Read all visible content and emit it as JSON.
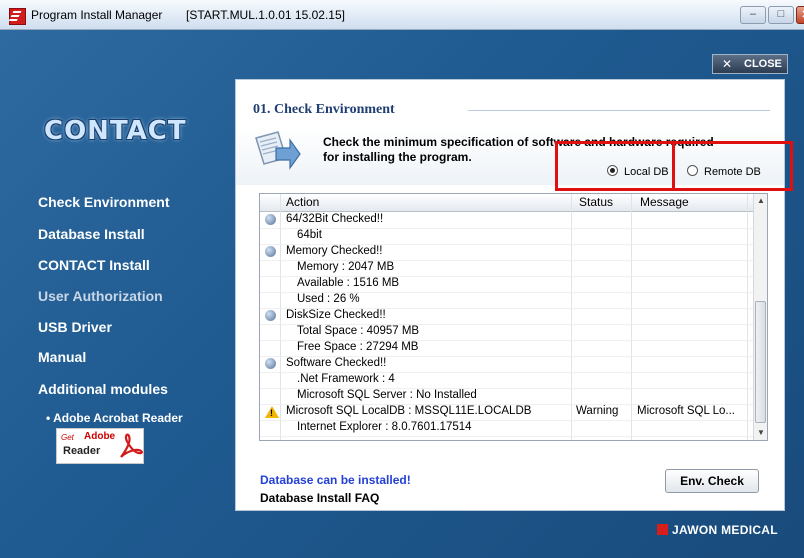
{
  "window": {
    "title": "Program Install Manager",
    "build": "[START.MUL.1.0.01 15.02.15]",
    "minimize": "–",
    "maximize": "□",
    "close": "✕"
  },
  "close_button": {
    "x": "✕",
    "label": "CLOSE"
  },
  "logo": "CONTACT",
  "nav": [
    {
      "label": "Check Environment"
    },
    {
      "label": "Database Install"
    },
    {
      "label": "CONTACT Install"
    },
    {
      "label": "User Authorization"
    },
    {
      "label": "USB Driver"
    },
    {
      "label": "Manual"
    },
    {
      "label": "Additional modules"
    }
  ],
  "modules": {
    "link": "• Adobe Acrobat Reader",
    "badge_get": "Get",
    "badge_adobe": "Adobe",
    "badge_reader": "Reader"
  },
  "panel": {
    "section_title": "01. Check Environment",
    "instruction_line1": "Check the minimum specification of software and hardware required",
    "instruction_line2": "for installing the program.",
    "radio_local": "Local DB",
    "radio_remote": "Remote DB",
    "radio_selected": "local"
  },
  "table": {
    "headers": {
      "action": "Action",
      "status": "Status",
      "message": "Message"
    },
    "rows": [
      {
        "icon": "ball",
        "action": "64/32Bit Checked!!",
        "status": "",
        "message": ""
      },
      {
        "icon": "",
        "action": "64bit",
        "status": "",
        "message": ""
      },
      {
        "icon": "ball",
        "action": "Memory Checked!!",
        "status": "",
        "message": ""
      },
      {
        "icon": "",
        "action": "Memory : 2047 MB",
        "status": "",
        "message": ""
      },
      {
        "icon": "",
        "action": "Available : 1516 MB",
        "status": "",
        "message": ""
      },
      {
        "icon": "",
        "action": "Used : 26 %",
        "status": "",
        "message": ""
      },
      {
        "icon": "ball",
        "action": "DiskSize Checked!!",
        "status": "",
        "message": ""
      },
      {
        "icon": "",
        "action": "Total Space : 40957 MB",
        "status": "",
        "message": ""
      },
      {
        "icon": "",
        "action": "Free Space : 27294 MB",
        "status": "",
        "message": ""
      },
      {
        "icon": "ball",
        "action": "Software Checked!!",
        "status": "",
        "message": ""
      },
      {
        "icon": "",
        "action": ".Net Framework : 4",
        "status": "",
        "message": ""
      },
      {
        "icon": "",
        "action": "Microsoft SQL Server : No Installed",
        "status": "",
        "message": ""
      },
      {
        "icon": "warning",
        "action": "Microsoft SQL LocalDB : MSSQL11E.LOCALDB",
        "status": "Warning",
        "message": "Microsoft SQL Lo..."
      },
      {
        "icon": "",
        "action": "Internet Explorer : 8.0.7601.17514",
        "status": "",
        "message": ""
      }
    ]
  },
  "status_text": "Database can be installed!",
  "faq_link": "Database Install FAQ",
  "env_check_button": "Env. Check",
  "brand": "JAWON MEDICAL",
  "colors": {
    "accent_red": "#e01010",
    "link_blue": "#2340d8",
    "title_navy": "#1f3f73"
  }
}
